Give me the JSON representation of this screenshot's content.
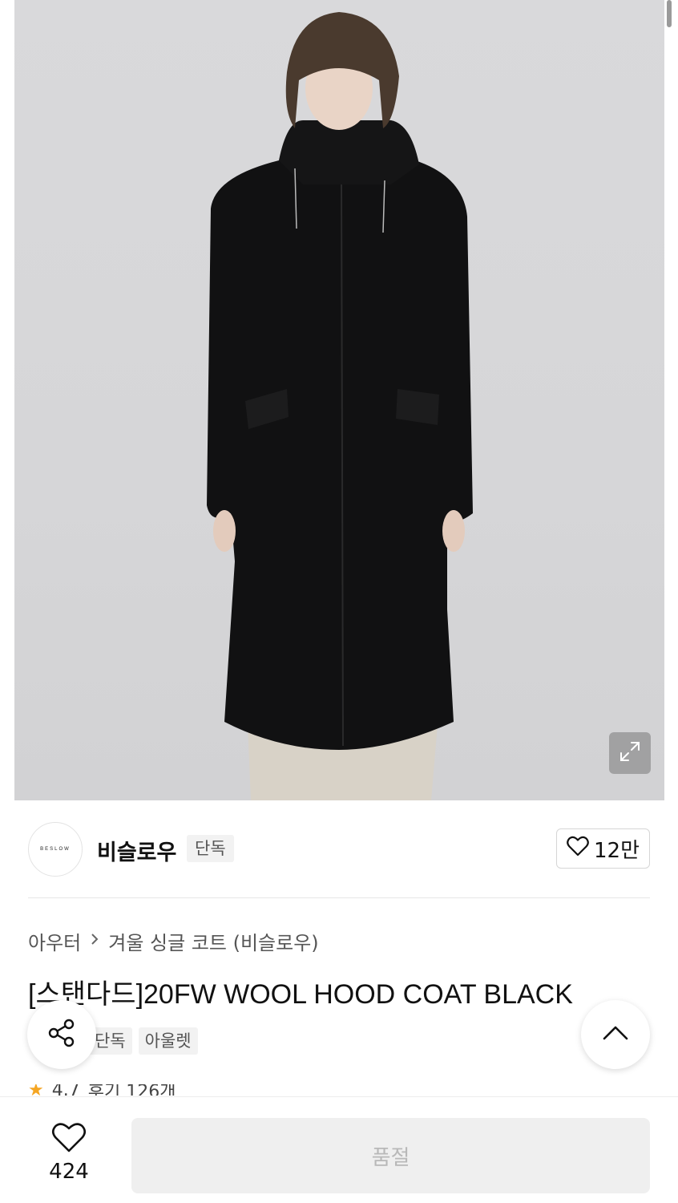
{
  "product": {
    "brand": {
      "logo_text": "BESLOW",
      "name": "비슬로우",
      "badge": "단독",
      "like_count": "12만"
    },
    "breadcrumb": [
      "아우터",
      "겨울 싱글 코트 (비슬로우)"
    ],
    "title": "[스탠다드]20FW WOOL HOOD COAT BLACK",
    "tags": [
      "단독",
      "아울렛"
    ],
    "rating": {
      "score": "4.7",
      "review_label": "후기 126개"
    }
  },
  "bottom_bar": {
    "like_count": "424",
    "buy_label": "품절"
  },
  "icons": {
    "expand": "expand-icon",
    "heart": "heart-icon",
    "share": "share-icon",
    "chevron_up": "chevron-up-icon",
    "star": "star-icon"
  },
  "colors": {
    "background": "#ffffff",
    "sold_out_button": "#efefef",
    "sold_out_text": "#b8b8b8",
    "star": "#f5a623"
  }
}
